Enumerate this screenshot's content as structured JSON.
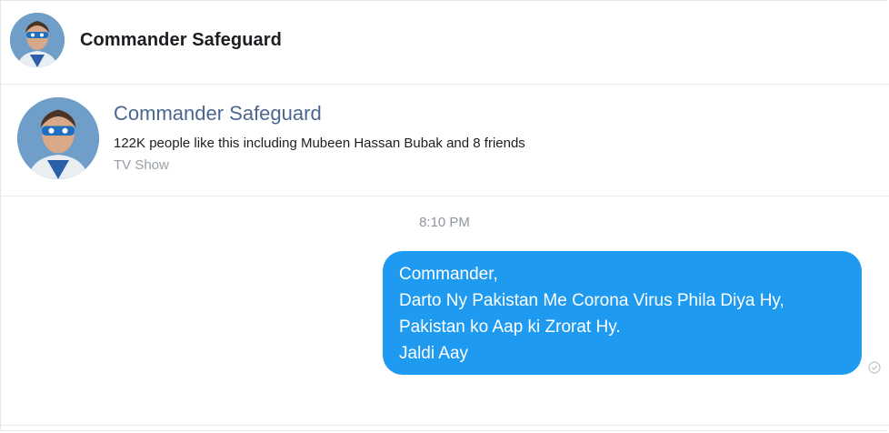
{
  "header": {
    "title": "Commander Safeguard",
    "avatar_icon": "commander-safeguard-avatar"
  },
  "page_card": {
    "name": "Commander Safeguard",
    "likes": "122K people like this including Mubeen Hassan Bubak and 8 friends",
    "category": "TV Show",
    "avatar_icon": "commander-safeguard-avatar"
  },
  "conversation": {
    "timestamp": "8:10 PM",
    "message": {
      "lines": [
        "Commander,",
        "Darto Ny Pakistan Me Corona Virus Phila Diya Hy,",
        "Pakistan ko Aap ki Zrorat Hy.",
        "Jaldi Aay"
      ],
      "bubble_color": "#1e9bf0",
      "status_icon": "sent-check-icon"
    }
  },
  "colors": {
    "page_name": "#4b6790",
    "muted_text": "#8d949e"
  }
}
